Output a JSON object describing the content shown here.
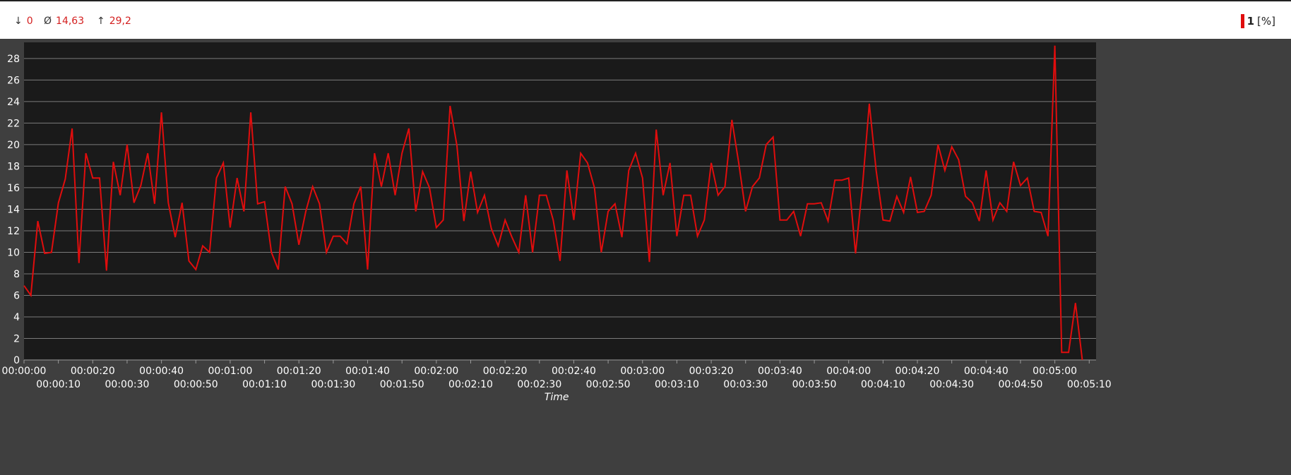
{
  "stats": {
    "min_symbol": "↓",
    "min_value": "0",
    "avg_symbol": "Ø",
    "avg_value": "14,63",
    "max_symbol": "↑",
    "max_value": "29,2"
  },
  "legend": {
    "series_name": "1",
    "unit": "[%]"
  },
  "colors": {
    "series": "#e00d0d",
    "plot_bg": "#1a1a1a",
    "frame_bg": "#3f3f3f",
    "grid": "#7a7a7a"
  },
  "chart_data": {
    "type": "line",
    "xlabel": "Time",
    "ylabel": "",
    "ylim": [
      0,
      29.5
    ],
    "xlim": [
      0,
      312
    ],
    "grid": true,
    "y_ticks": [
      0,
      2,
      4,
      6,
      8,
      10,
      12,
      14,
      16,
      18,
      20,
      22,
      24,
      26,
      28
    ],
    "x_ticks_top": [
      "00:00:00",
      "00:00:20",
      "00:00:40",
      "00:01:00",
      "00:01:20",
      "00:01:40",
      "00:02:00",
      "00:02:20",
      "00:02:40",
      "00:03:00",
      "00:03:20",
      "00:03:40",
      "00:04:00",
      "00:04:20",
      "00:04:40",
      "00:05:00"
    ],
    "x_ticks_bottom": [
      "00:00:10",
      "00:00:30",
      "00:00:50",
      "00:01:10",
      "00:01:30",
      "00:01:50",
      "00:02:10",
      "00:02:30",
      "00:02:50",
      "00:03:10",
      "00:03:30",
      "00:03:50",
      "00:04:10",
      "00:04:30",
      "00:04:50",
      "00:05:10"
    ],
    "series": [
      {
        "name": "1",
        "x_step_seconds": 2,
        "values": [
          6.9,
          6.0,
          12.9,
          9.9,
          10.0,
          14.6,
          16.8,
          21.5,
          9.0,
          19.2,
          16.9,
          16.9,
          8.3,
          18.4,
          15.3,
          20.0,
          14.6,
          16.2,
          19.2,
          14.5,
          23.0,
          14.6,
          11.4,
          14.6,
          9.2,
          8.4,
          10.6,
          10.0,
          16.9,
          18.3,
          12.3,
          16.9,
          13.8,
          23.0,
          14.5,
          14.7,
          10.0,
          8.4,
          16.1,
          14.5,
          10.7,
          13.8,
          16.1,
          14.5,
          10.0,
          11.5,
          11.5,
          10.8,
          14.5,
          16.1,
          8.4,
          19.2,
          16.1,
          19.2,
          15.3,
          19.2,
          21.5,
          13.8,
          17.5,
          16.0,
          12.3,
          13.0,
          23.6,
          19.9,
          12.9,
          17.5,
          13.7,
          15.3,
          12.2,
          10.6,
          13.0,
          11.4,
          10.0,
          15.3,
          10.0,
          15.3,
          15.3,
          13.0,
          9.2,
          17.6,
          13.0,
          19.2,
          18.3,
          16.0,
          10.0,
          13.8,
          14.5,
          11.4,
          17.6,
          19.2,
          16.9,
          9.1,
          21.4,
          15.3,
          18.3,
          11.5,
          15.3,
          15.3,
          11.5,
          13.0,
          18.3,
          15.3,
          16.1,
          22.3,
          18.3,
          13.8,
          16.1,
          16.9,
          20.0,
          20.7,
          13.0,
          13.0,
          13.8,
          11.5,
          14.5,
          14.5,
          14.6,
          12.9,
          16.7,
          16.7,
          16.9,
          9.9,
          16.1,
          23.8,
          17.6,
          13.0,
          12.9,
          15.2,
          13.7,
          17.0,
          13.7,
          13.8,
          15.3,
          20.0,
          17.6,
          19.8,
          18.6,
          15.2,
          14.6,
          12.9,
          17.6,
          13.0,
          14.6,
          13.8,
          18.4,
          16.2,
          16.9,
          13.8,
          13.7,
          11.5,
          29.2,
          0.7,
          0.7,
          5.3,
          0
        ]
      }
    ]
  }
}
